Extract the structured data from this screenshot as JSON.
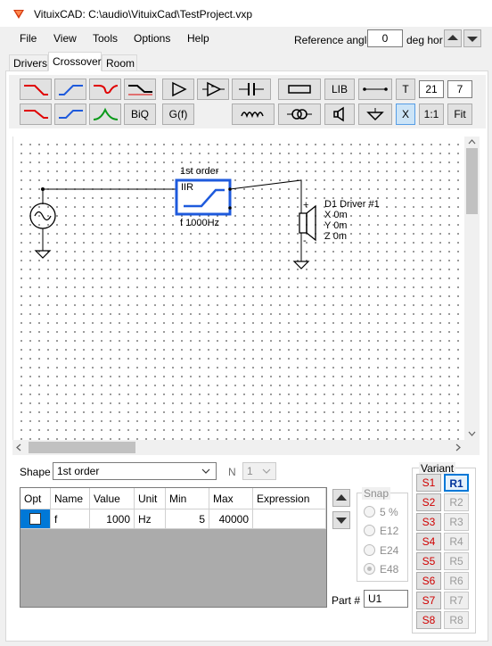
{
  "window": {
    "title": "VituixCAD: C:\\audio\\VituixCad\\TestProject.vxp"
  },
  "menu": {
    "items": [
      "File",
      "View",
      "Tools",
      "Options",
      "Help"
    ]
  },
  "reference_angle": {
    "label": "Reference angle",
    "value": "0",
    "unit_label": "deg hor"
  },
  "tabs": [
    "Drivers",
    "Crossover",
    "Room"
  ],
  "active_tab": "Crossover",
  "palette": {
    "biq_label": "BiQ",
    "gf_label": "G(f)",
    "lib_label": "LIB",
    "t_label": "T",
    "x_label": "X",
    "one_to_one_label": "1:1",
    "fit_label": "Fit",
    "field_a": "21",
    "field_b": "7",
    "colors": {
      "red": "#e00000",
      "blue": "#1e5adc",
      "green": "#0a9a1a"
    }
  },
  "schematic": {
    "filter_title": "1st order",
    "filter_type": "IIR",
    "filter_param": "f  1000Hz",
    "driver_lines": [
      "D1 Driver #1",
      "X 0m",
      "Y 0m",
      "Z 0m"
    ],
    "plus": "+",
    "minus": "-",
    "accent": "#1e5adc"
  },
  "shape": {
    "label": "Shape",
    "value": "1st order",
    "n_label": "N",
    "n_value": "1"
  },
  "params_table": {
    "columns": [
      "Opt",
      "Name",
      "Value",
      "Unit",
      "Min",
      "Max",
      "Expression"
    ],
    "rows": [
      {
        "opt": false,
        "name": "f",
        "value": "1000",
        "unit": "Hz",
        "min": "5",
        "max": "40000",
        "expression": ""
      }
    ]
  },
  "snap": {
    "title": "Snap",
    "options": [
      "5 %",
      "E12",
      "E24",
      "E48"
    ],
    "selected": "E48"
  },
  "part": {
    "label": "Part #",
    "value": "U1"
  },
  "variant": {
    "title": "Variant",
    "s_buttons": [
      "S1",
      "S2",
      "S3",
      "S4",
      "S5",
      "S6",
      "S7",
      "S8"
    ],
    "r_buttons": [
      "R1",
      "R2",
      "R3",
      "R4",
      "R5",
      "R6",
      "R7",
      "R8"
    ],
    "active": "R1"
  }
}
